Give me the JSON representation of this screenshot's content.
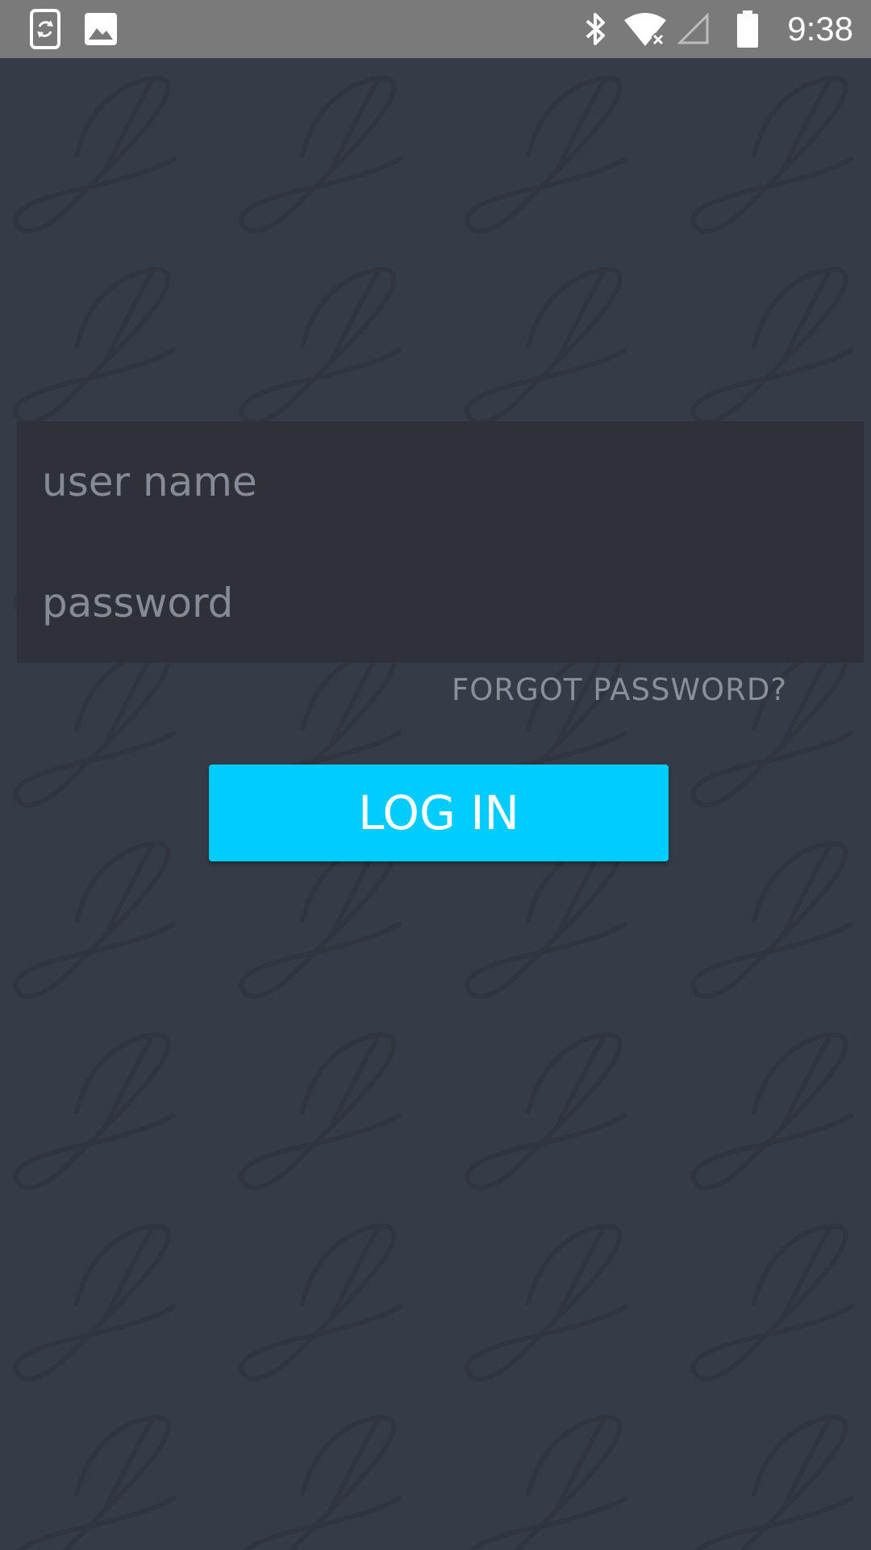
{
  "status_bar": {
    "time": "9:38",
    "icons": [
      "screen-rotation-icon",
      "image-icon",
      "bluetooth-icon",
      "wifi-no-internet-icon",
      "cellular-signal-empty-icon",
      "battery-full-icon"
    ],
    "background": "#7a7a7a"
  },
  "login": {
    "username_placeholder": "user name",
    "password_placeholder": "password",
    "forgot_password_label": "FORGOT PASSWORD?",
    "login_button_label": "LOG IN"
  },
  "colors": {
    "background": "#363c47",
    "form_background": "#2e3139",
    "accent": "#00ccff",
    "placeholder_text": "#858a94"
  }
}
